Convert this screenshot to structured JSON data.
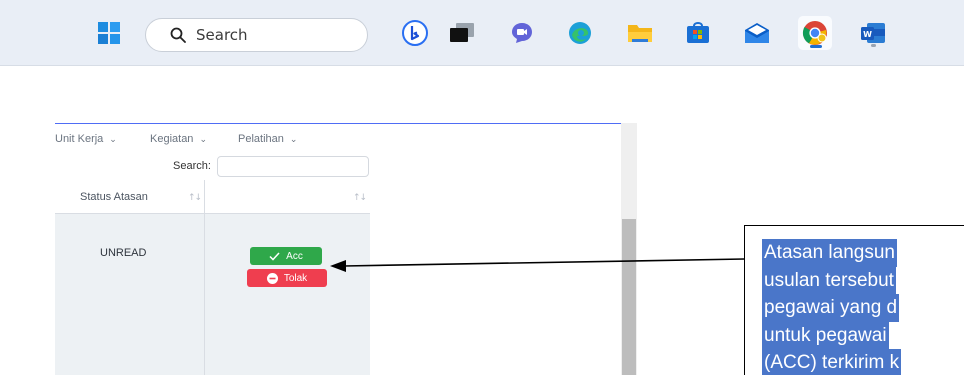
{
  "taskbar": {
    "search_placeholder": "Search",
    "apps": [
      "start-icon",
      "bing-icon",
      "task-view-icon",
      "teams-chat-icon",
      "edge-icon",
      "file-explorer-icon",
      "microsoft-store-icon",
      "mail-icon",
      "chrome-icon",
      "word-icon"
    ],
    "active_app": "chrome-icon"
  },
  "app": {
    "menu": {
      "unit_kerja": "Unit Kerja",
      "kegiatan": "Kegiatan",
      "pelatihan": "Pelatihan"
    },
    "search_label": "Search:",
    "search_value": "",
    "table": {
      "col_status": "Status Atasan",
      "sort_glyph": "↑↓",
      "row_status": "UNREAD"
    },
    "buttons": {
      "acc": "Acc",
      "tolak": "Tolak"
    },
    "colors": {
      "acc": "#2fa84a",
      "tolak": "#ef3e4f",
      "row_bg": "#edf1f4"
    }
  },
  "callout": {
    "lines": [
      "Atasan langsun",
      "usulan tersebut",
      "pegawai yang d",
      "untuk pegawai",
      "(ACC) terkirim k"
    ],
    "highlight": "#4a76c9"
  }
}
